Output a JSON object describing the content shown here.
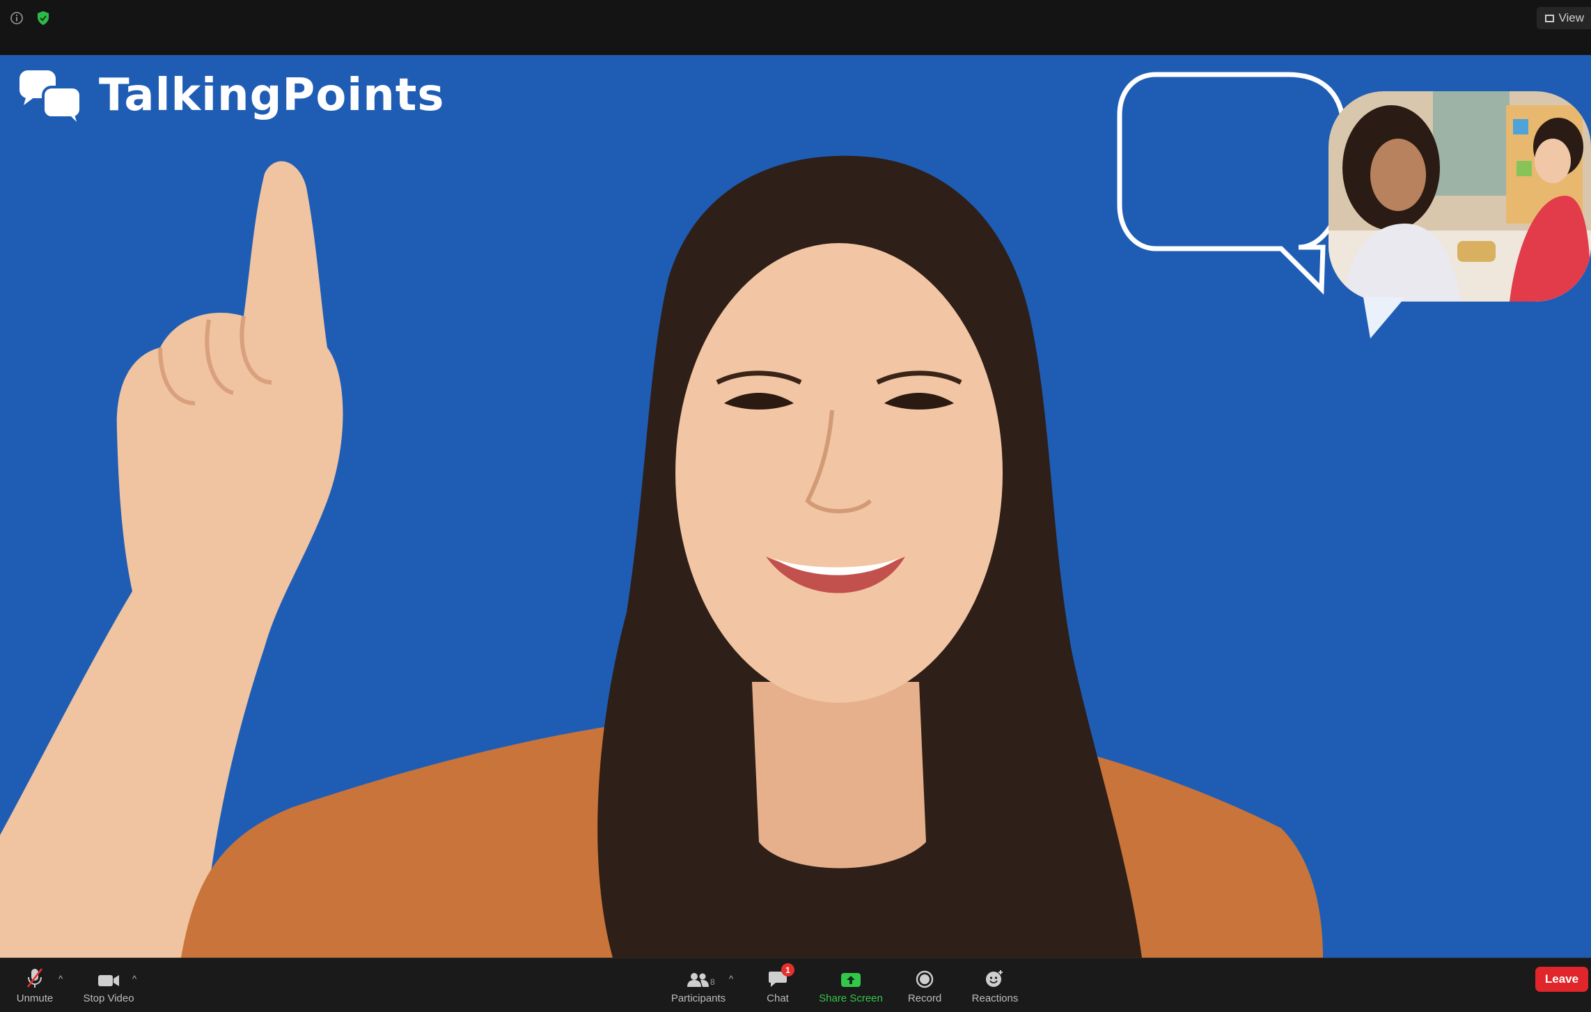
{
  "topbar": {
    "view_label": "View",
    "icons": [
      "info-icon",
      "shield-check-icon",
      "grid-view-icon"
    ]
  },
  "video": {
    "background_color": "#1f5db5",
    "brand_name": "TalkingPoints",
    "brand_icon": "chat-bubbles-logo"
  },
  "toolbar": {
    "unmute_label": "Unmute",
    "stop_video_label": "Stop Video",
    "participants_label": "Participants",
    "participants_count": "8",
    "chat_label": "Chat",
    "chat_badge": "1",
    "share_screen_label": "Share Screen",
    "record_label": "Record",
    "reactions_label": "Reactions",
    "leave_label": "Leave",
    "accent_green": "#33c84a",
    "leave_color": "#e0262a"
  }
}
